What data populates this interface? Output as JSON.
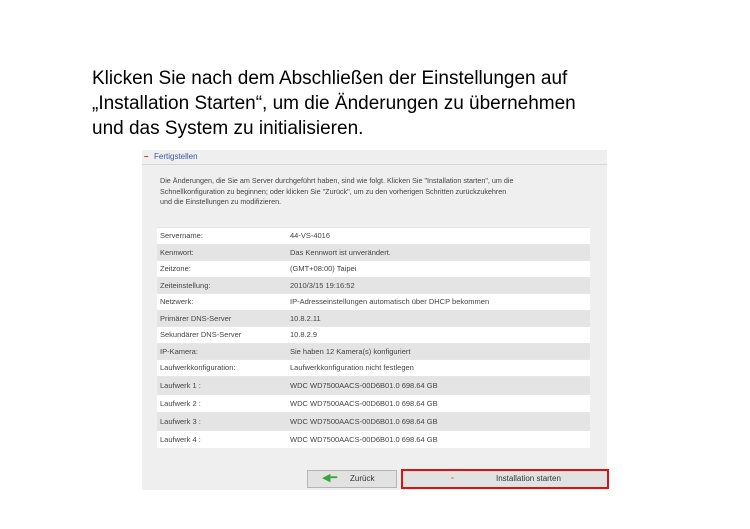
{
  "heading": {
    "line1": "Klicken Sie nach dem Abschließen der Einstellungen auf",
    "line2": "„Installation Starten“, um die Änderungen zu übernehmen",
    "line3": "und das System zu initialisieren."
  },
  "panel": {
    "collapse_symbol": "–",
    "title": "Fertigstellen",
    "intro": [
      "Die Änderungen, die Sie am Server durchgeführt haben, sind wie folgt. Klicken Sie \"Installation starten\", um die",
      "Schnellkonfiguration zu beginnen; oder klicken Sie \"Zurück\", um zu den vorherigen Schritten zurückzukehren",
      "und die Einstellungen zu modifizieren."
    ],
    "rows": [
      {
        "key": "Servername:",
        "value": "44-VS-4016"
      },
      {
        "key": "Kennwort:",
        "value": "Das Kennwort ist unverändert."
      },
      {
        "key": "Zeitzone:",
        "value": "(GMT+08:00) Taipei"
      },
      {
        "key": "Zeiteinstellung:",
        "value": "2010/3/15 19:16:52"
      },
      {
        "key": "Netzwerk:",
        "value": "IP-Adresseinstellungen automatisch über DHCP bekommen"
      },
      {
        "key": "Primärer DNS-Server",
        "value": "10.8.2.11"
      },
      {
        "key": "Sekundärer DNS-Server",
        "value": "10.8.2.9"
      },
      {
        "key": "IP-Kamera:",
        "value": "Sie haben 12 Kamera(s) konfiguriert"
      },
      {
        "key": "Laufwerkkonfiguration:",
        "value": "Laufwerkkonfiguration nicht festlegen"
      },
      {
        "key": "Laufwerk 1 :",
        "value": "WDC WD7500AACS-00D6B01.0  698.64 GB"
      },
      {
        "key": "Laufwerk 2 :",
        "value": "WDC WD7500AACS-00D6B01.0  698.64 GB"
      },
      {
        "key": "Laufwerk 3 :",
        "value": "WDC WD7500AACS-00D6B01.0  698.64 GB"
      },
      {
        "key": "Laufwerk 4 :",
        "value": "WDC WD7500AACS-00D6B01.0  698.64 GB"
      }
    ],
    "buttons": {
      "back_label": "Zurück",
      "back_icon": "arrow-left-icon",
      "install_label": "Installation starten",
      "install_icon": "dash-icon",
      "install_symbol": "-"
    }
  },
  "colors": {
    "panel_bg": "#efefef",
    "accent_red": "#dd1111",
    "title_blue": "#3a55a6",
    "arrow_green": "#3da33d"
  }
}
